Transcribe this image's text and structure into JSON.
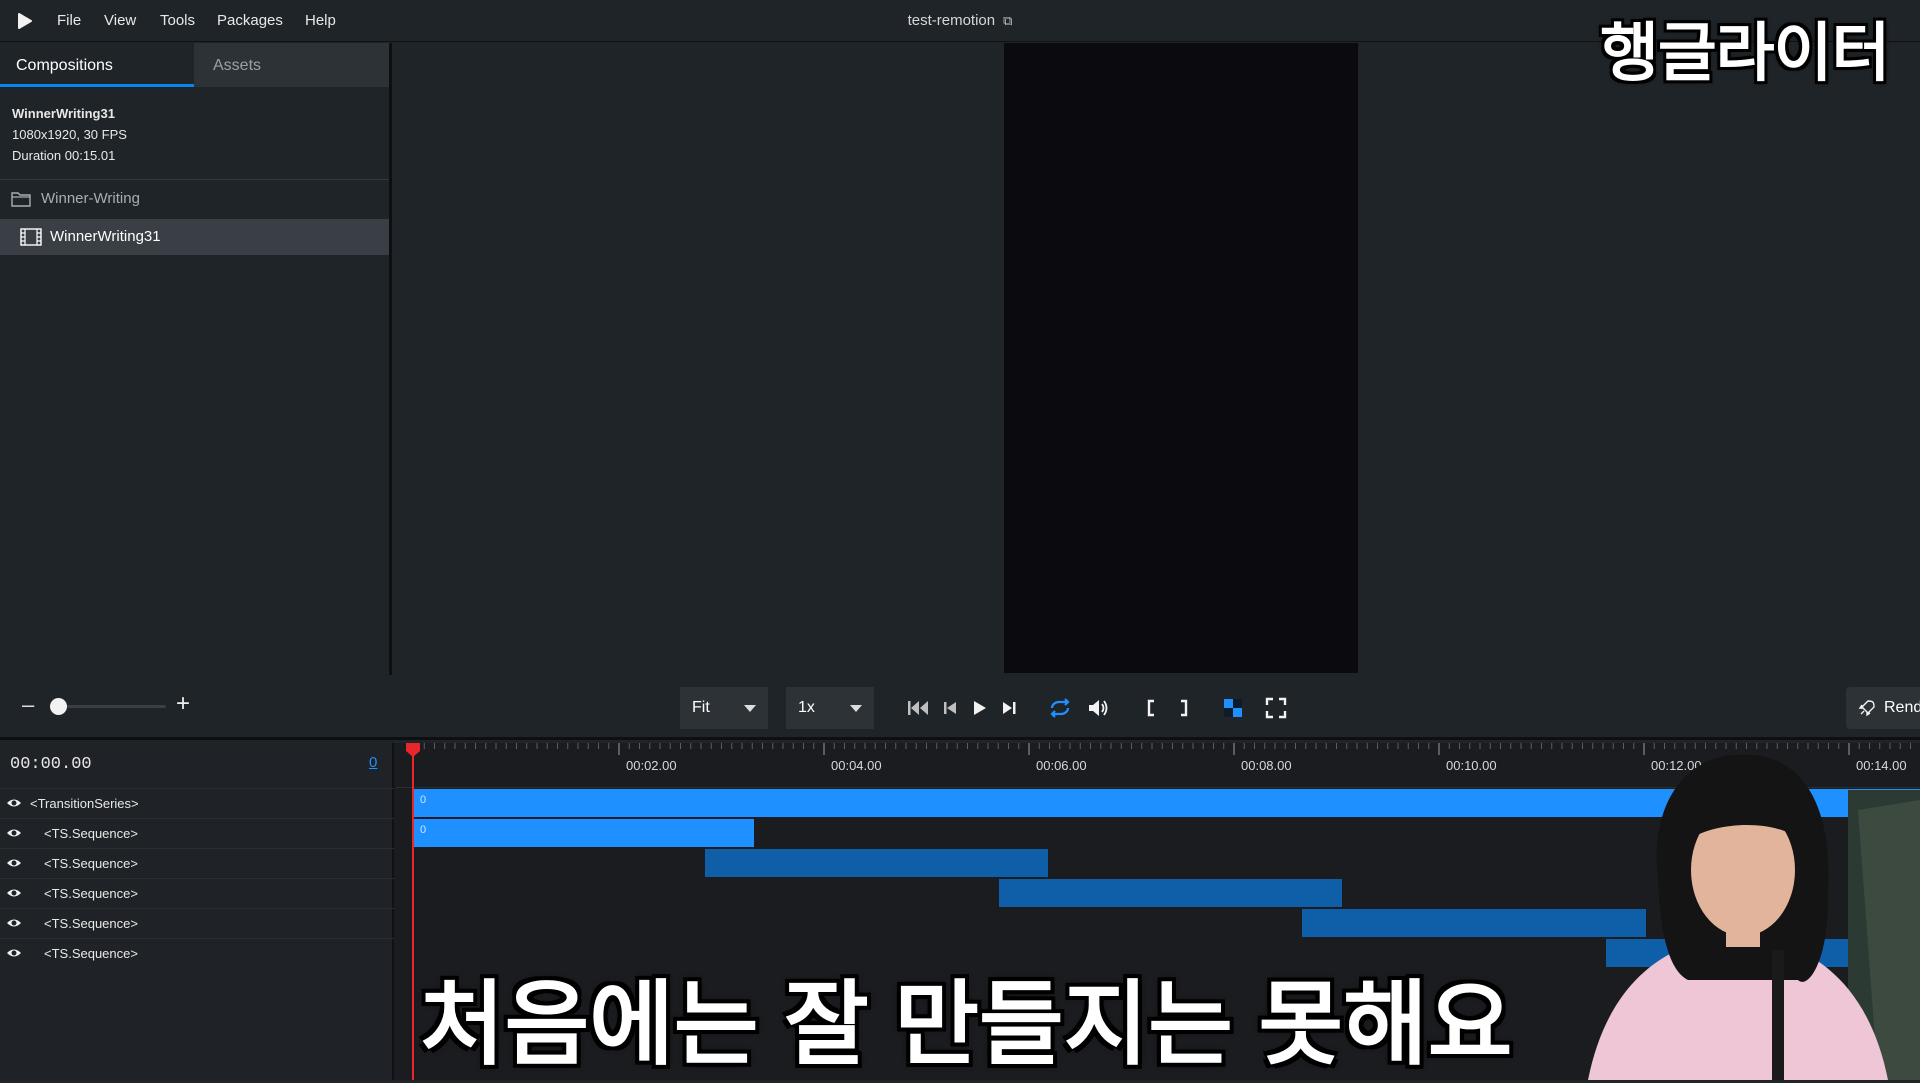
{
  "menubar": {
    "items": [
      "File",
      "View",
      "Tools",
      "Packages",
      "Help"
    ],
    "project_title": "test-remotion"
  },
  "sidebar": {
    "tabs": {
      "compositions": "Compositions",
      "assets": "Assets"
    },
    "composition": {
      "name": "WinnerWriting31",
      "resolution": "1080x1920, 30 FPS",
      "duration": "Duration 00:15.01"
    },
    "folder": "Winner-Writing",
    "selected_item": "WinnerWriting31"
  },
  "controls": {
    "zoom_level": 0.0,
    "fit_label": "Fit",
    "speed_label": "1x",
    "render_label": "Render"
  },
  "timeline": {
    "timecode": "00:00.00",
    "frame": "0",
    "ticks": [
      "00:02.00",
      "00:04.00",
      "00:06.00",
      "00:08.00",
      "00:10.00",
      "00:12.00",
      "00:14.00"
    ],
    "layers": [
      "<TransitionSeries>",
      "<TS.Sequence>",
      "<TS.Sequence>",
      "<TS.Sequence>",
      "<TS.Sequence>",
      "<TS.Sequence>"
    ],
    "bar_labels": [
      "0",
      "0"
    ]
  },
  "overlay": {
    "channel_name": "행글라이터",
    "subtitle": "처음에는 잘 만들지는 못해요"
  },
  "colors": {
    "accent": "#0b84f3",
    "bar_primary": "#1e90ff",
    "bar_secondary": "#0f5fa8",
    "playhead": "#e8262b"
  }
}
